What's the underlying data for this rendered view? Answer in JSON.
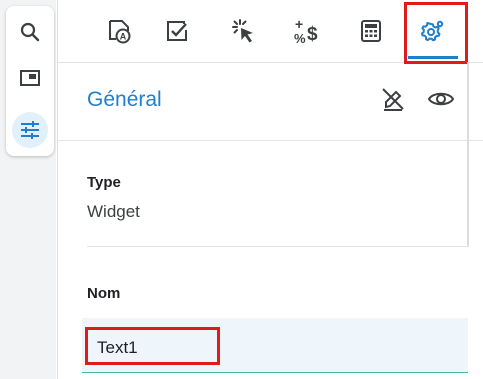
{
  "left_rail": {
    "items": [
      {
        "icon": "search-icon"
      },
      {
        "icon": "panel-icon"
      },
      {
        "icon": "sliders-icon",
        "active": true
      }
    ]
  },
  "toolbar": {
    "tabs": [
      {
        "icon": "format-icon"
      },
      {
        "icon": "checkbox-icon"
      },
      {
        "icon": "click-icon"
      },
      {
        "icon": "currency-percent-icon"
      },
      {
        "icon": "calculator-icon"
      },
      {
        "icon": "settings-gear-icon",
        "active": true
      }
    ]
  },
  "section": {
    "title": "Général"
  },
  "fields": {
    "type_label": "Type",
    "type_value": "Widget",
    "name_label": "Nom",
    "name_value": "Text1"
  },
  "colors": {
    "accent": "#1f7fcf",
    "highlight": "#e01b1b",
    "input_bg": "#eef5fb"
  }
}
